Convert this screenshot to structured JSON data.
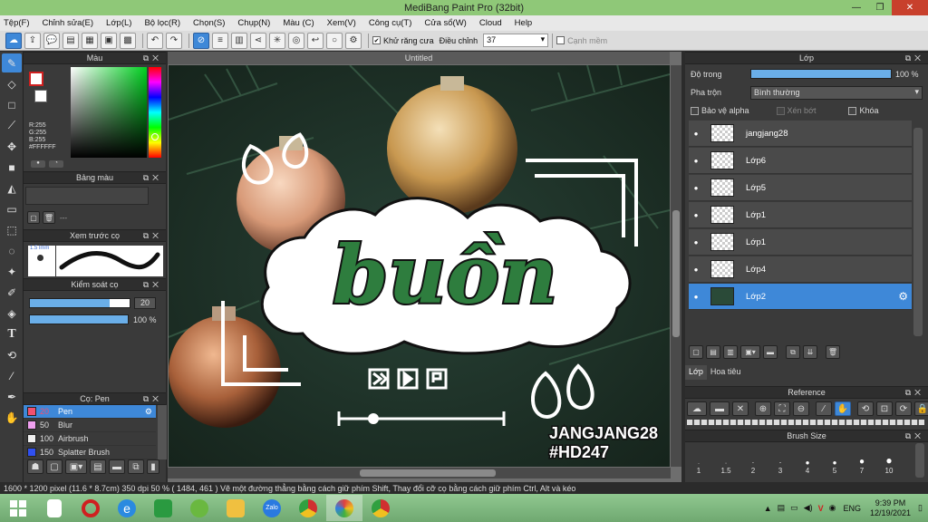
{
  "window": {
    "title": "MediBang Paint Pro (32bit)"
  },
  "menu": [
    "Tệp(F)",
    "Chỉnh sửa(E)",
    "Lớp(L)",
    "Bộ lọc(R)",
    "Chọn(S)",
    "Chụp(N)",
    "Màu (C)",
    "Xem(V)",
    "Công cụ(T)",
    "Cửa sổ(W)",
    "Cloud",
    "Help"
  ],
  "toolbar": {
    "antialias_label": "Khử răng cưa",
    "adjust_label": "Điều chỉnh",
    "adjust_value": "37",
    "sharp_label": "Cạnh mềm"
  },
  "color_panel": {
    "title": "Màu",
    "r": "R:255",
    "g": "G:255",
    "b": "B:255",
    "hex": "#FFFFFF"
  },
  "palette_panel": {
    "title": "Bảng màu",
    "value": "---"
  },
  "brush_preview": {
    "title": "Xem trước cọ",
    "size": "1.5 lmm"
  },
  "brush_control": {
    "title": "Kiểm soát cọ",
    "size_value": "20",
    "opacity_value": "100 %",
    "opacity_pct": 100,
    "size_pct": 80
  },
  "brush_list": {
    "title": "Cọ: Pen",
    "items": [
      {
        "size": "20",
        "name": "Pen",
        "color": "#f05070",
        "selected": true
      },
      {
        "size": "50",
        "name": "Blur",
        "color": "#f0a0f0",
        "selected": false
      },
      {
        "size": "100",
        "name": "Airbrush",
        "color": "#f0f0f0",
        "selected": false
      },
      {
        "size": "150",
        "name": "Splatter Brush",
        "color": "#3050f0",
        "selected": false
      }
    ]
  },
  "document": {
    "tab": "Untitled"
  },
  "artwork": {
    "word": "buồn",
    "caption1": "JANGJANG28",
    "caption2": "#HD247",
    "colors": {
      "green": "#2e7d3e",
      "white": "#ffffff",
      "black": "#111111"
    }
  },
  "layer_panel": {
    "title": "Lớp",
    "opacity_label": "Độ trong",
    "opacity_value": "100 %",
    "opacity_pct": 100,
    "blend_label": "Pha trộn",
    "blend_value": "Bình thường",
    "protect_alpha": "Bảo vệ alpha",
    "clip": "Xén bớt",
    "lock": "Khóa",
    "layers": [
      {
        "name": "jangjang28",
        "selected": false
      },
      {
        "name": "Lớp6",
        "selected": false
      },
      {
        "name": "Lớp5",
        "selected": false
      },
      {
        "name": "Lớp1",
        "selected": false
      },
      {
        "name": "Lớp1",
        "selected": false
      },
      {
        "name": "Lớp4",
        "selected": false
      },
      {
        "name": "Lớp2",
        "selected": true
      }
    ],
    "tabs": [
      "Lớp",
      "Hoa tiêu"
    ]
  },
  "reference_panel": {
    "title": "Reference"
  },
  "brush_size_panel": {
    "title": "Brush Size",
    "sizes": [
      "1",
      "1.5",
      "2",
      "3",
      "4",
      "5",
      "7",
      "10"
    ]
  },
  "status": {
    "text": "1600 * 1200 pixel   (11.6 * 8.7cm)   350 dpi   50 %   ( 1484, 461 )   Vẽ một đường thẳng bằng cách giữ phím Shift, Thay đổi cỡ cọ bằng cách giữ phím Ctrl, Alt và kéo"
  },
  "taskbar": {
    "lang": "ENG",
    "time": "9:39 PM",
    "date": "12/19/2021"
  }
}
